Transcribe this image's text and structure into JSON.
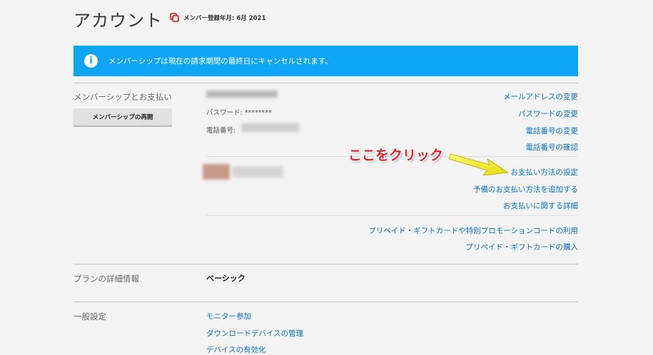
{
  "header": {
    "title": "アカウント",
    "member_since": "メンバー登録年月: 6月 2021"
  },
  "notice": {
    "text": "メンバーシップは現在の請求期間の最終日にキャンセルされます。",
    "icon": "info-icon"
  },
  "membership": {
    "section_title": "メンバーシップとお支払い",
    "restart_button": "メンバーシップの再開",
    "password_label": "パスワード: ********",
    "phone_label": "電話番号:",
    "links": {
      "change_email": "メールアドレスの変更",
      "change_password": "パスワードの変更",
      "change_phone": "電話番号の変更",
      "verify_phone": "電話番号の確認",
      "payment_method": "お支払い方法の設定",
      "add_backup_payment": "予備のお支払い方法を追加する",
      "billing_details": "お支払いに関する詳細",
      "redeem_gift": "プリペイド・ギフトカードや特別プロモーションコードの利用",
      "buy_gift": "プリペイド・ギフトカードの購入"
    }
  },
  "annotation": {
    "text": "ここをクリック",
    "color": "#e8212e",
    "arrow_color": "#f5f228"
  },
  "plan": {
    "section_title": "プランの詳細情報",
    "value": "ベーシック"
  },
  "settings": {
    "section_title": "一般設定",
    "links": [
      "モニター参加",
      "ダウンロードデバイスの管理",
      "デバイスの有効化"
    ]
  },
  "colors": {
    "accent_blue": "#0ea5f5",
    "link_blue": "#0a6fc4",
    "brand_red": "#e50914"
  }
}
